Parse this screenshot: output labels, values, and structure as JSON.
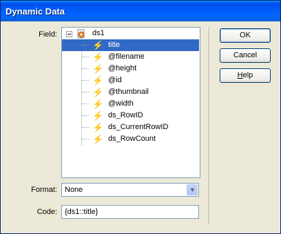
{
  "window": {
    "title": "Dynamic Data"
  },
  "labels": {
    "field": "Field:",
    "format": "Format:",
    "code": "Code:"
  },
  "tree": {
    "root": {
      "label": "ds1",
      "expander": "−"
    },
    "items": [
      {
        "label": "title",
        "selected": true,
        "icon": "lightning-icon"
      },
      {
        "label": "@filename",
        "icon": "lightning-icon"
      },
      {
        "label": "@height",
        "icon": "lightning-icon"
      },
      {
        "label": "@id",
        "icon": "lightning-icon"
      },
      {
        "label": "@thumbnail",
        "icon": "lightning-icon"
      },
      {
        "label": "@width",
        "icon": "lightning-icon"
      },
      {
        "label": "ds_RowID",
        "icon": "lightning-icon"
      },
      {
        "label": "ds_CurrentRowID",
        "icon": "lightning-icon"
      },
      {
        "label": "ds_RowCount",
        "icon": "lightning-icon"
      }
    ]
  },
  "format": {
    "value": "None"
  },
  "code": {
    "value": "{ds1::title}"
  },
  "buttons": {
    "ok": "OK",
    "cancel": "Cancel",
    "help": "Help"
  },
  "colors": {
    "titlebar": "#0054e3",
    "selection": "#316ac5",
    "dialog": "#ece9d8"
  }
}
